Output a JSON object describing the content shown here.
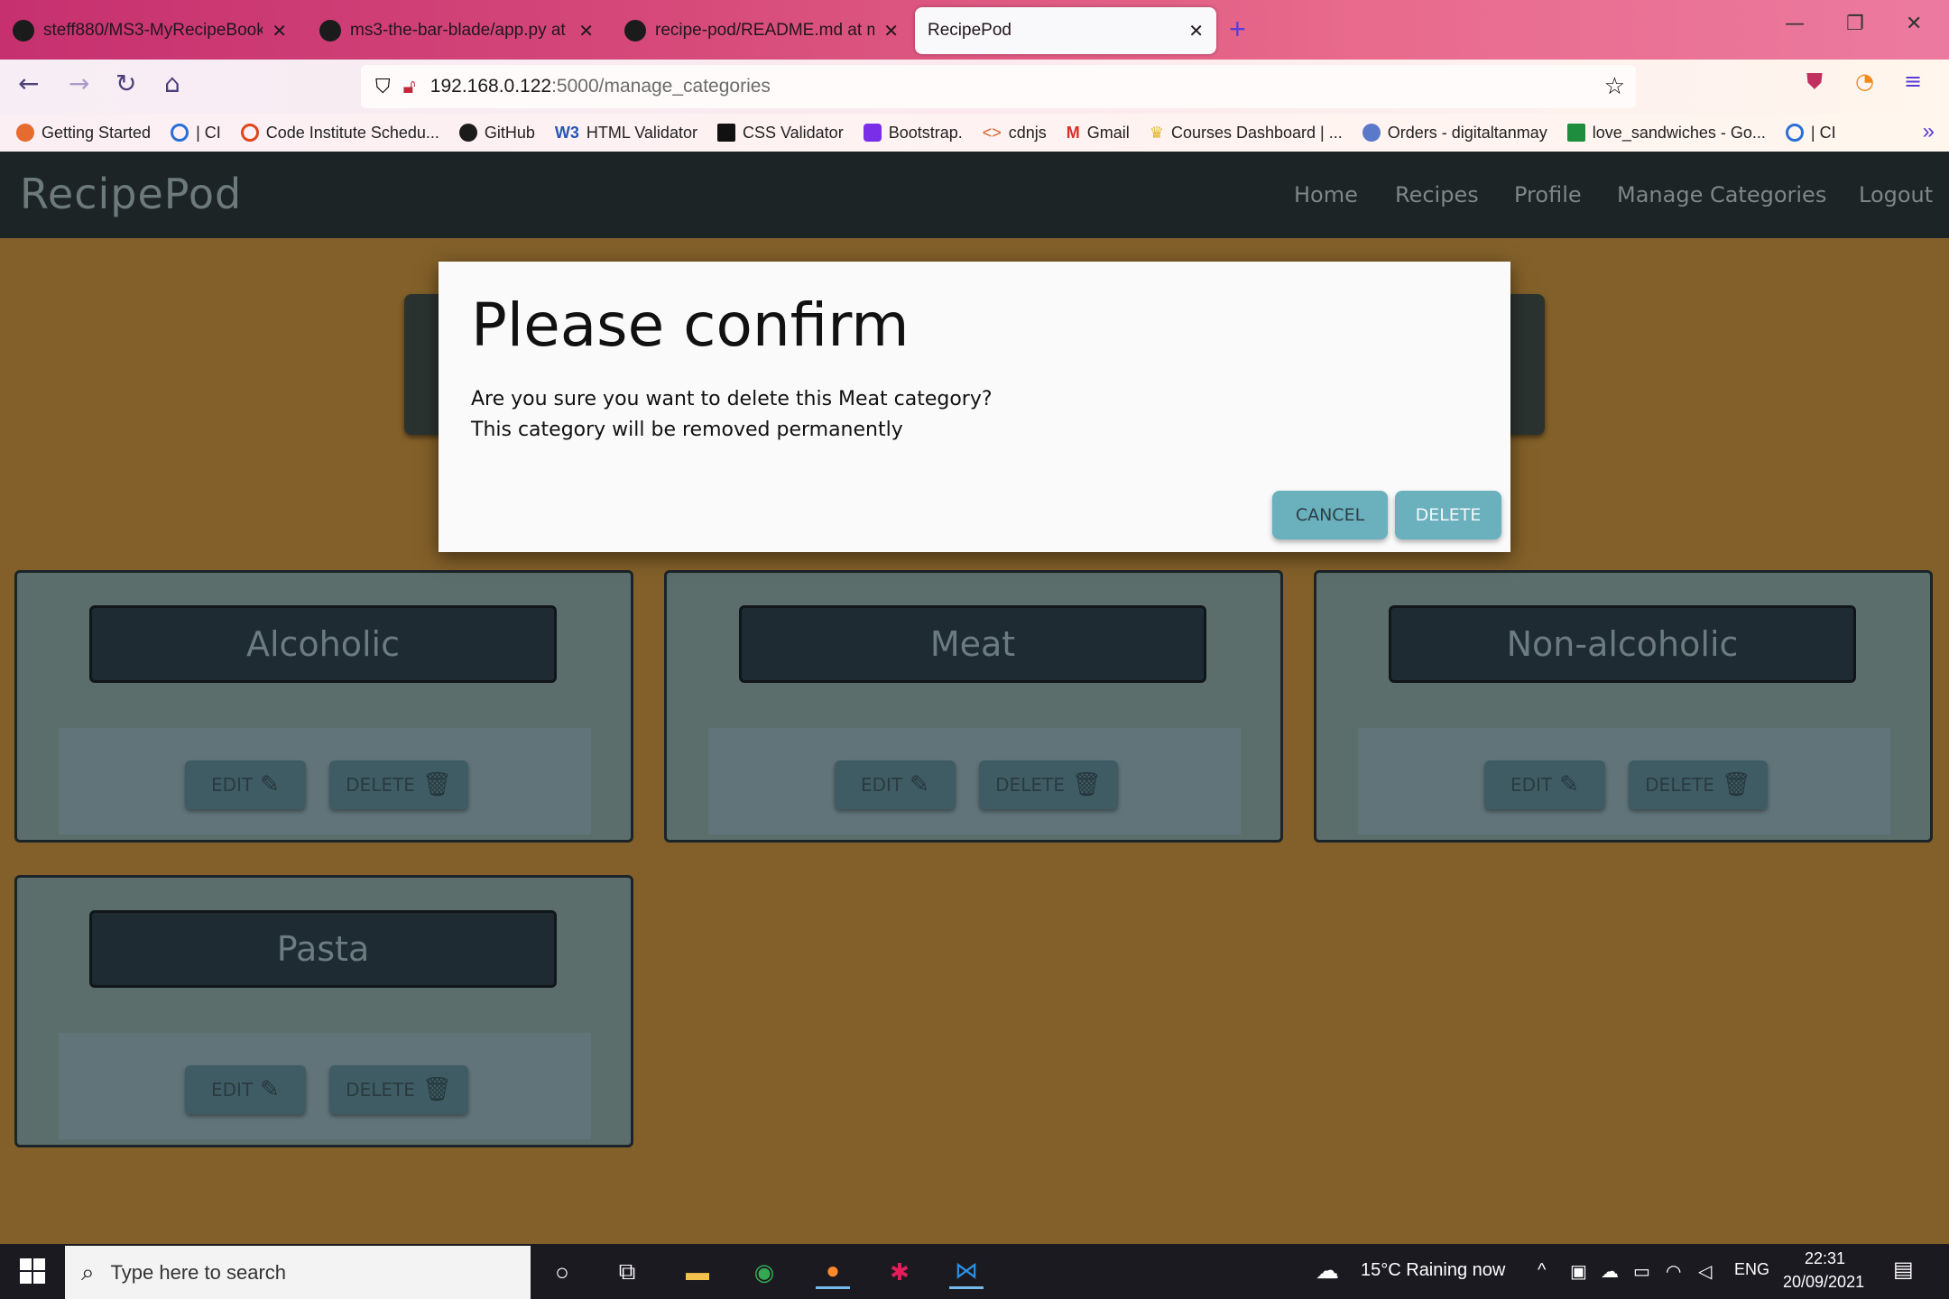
{
  "browser": {
    "tabs": [
      {
        "title": "steff880/MS3-MyRecipeBook"
      },
      {
        "title": "ms3-the-bar-blade/app.py at m"
      },
      {
        "title": "recipe-pod/README.md at mai"
      },
      {
        "title": "RecipePod"
      }
    ],
    "url_host": "192.168.0.122",
    "url_path": ":5000/manage_categories",
    "bookmarks": [
      {
        "label": "Getting Started"
      },
      {
        "label": "| CI"
      },
      {
        "label": "Code Institute Schedu..."
      },
      {
        "label": "GitHub"
      },
      {
        "label": "HTML Validator"
      },
      {
        "label": "CSS Validator"
      },
      {
        "label": "Bootstrap."
      },
      {
        "label": "cdnjs"
      },
      {
        "label": "Gmail"
      },
      {
        "label": "Courses Dashboard | ..."
      },
      {
        "label": "Orders - digitaltanmay"
      },
      {
        "label": "love_sandwiches - Go..."
      },
      {
        "label": "| CI"
      }
    ]
  },
  "site": {
    "brand": "RecipePod",
    "nav": [
      "Home",
      "Recipes",
      "Profile",
      "Manage Categories",
      "Logout"
    ]
  },
  "categories": [
    {
      "name": "Alcoholic"
    },
    {
      "name": "Meat"
    },
    {
      "name": "Non-alcoholic"
    },
    {
      "name": "Pasta"
    }
  ],
  "category_buttons": {
    "edit": "EDIT",
    "delete": "DELETE"
  },
  "modal": {
    "title": "Please confirm",
    "line1": "Are you sure you want to delete this Meat category?",
    "line2": "This category will be removed permanently",
    "cancel": "CANCEL",
    "delete": "DELETE"
  },
  "taskbar": {
    "search_placeholder": "Type here to search",
    "weather": "15°C  Raining now",
    "lang": "ENG",
    "time": "22:31",
    "date": "20/09/2021"
  }
}
